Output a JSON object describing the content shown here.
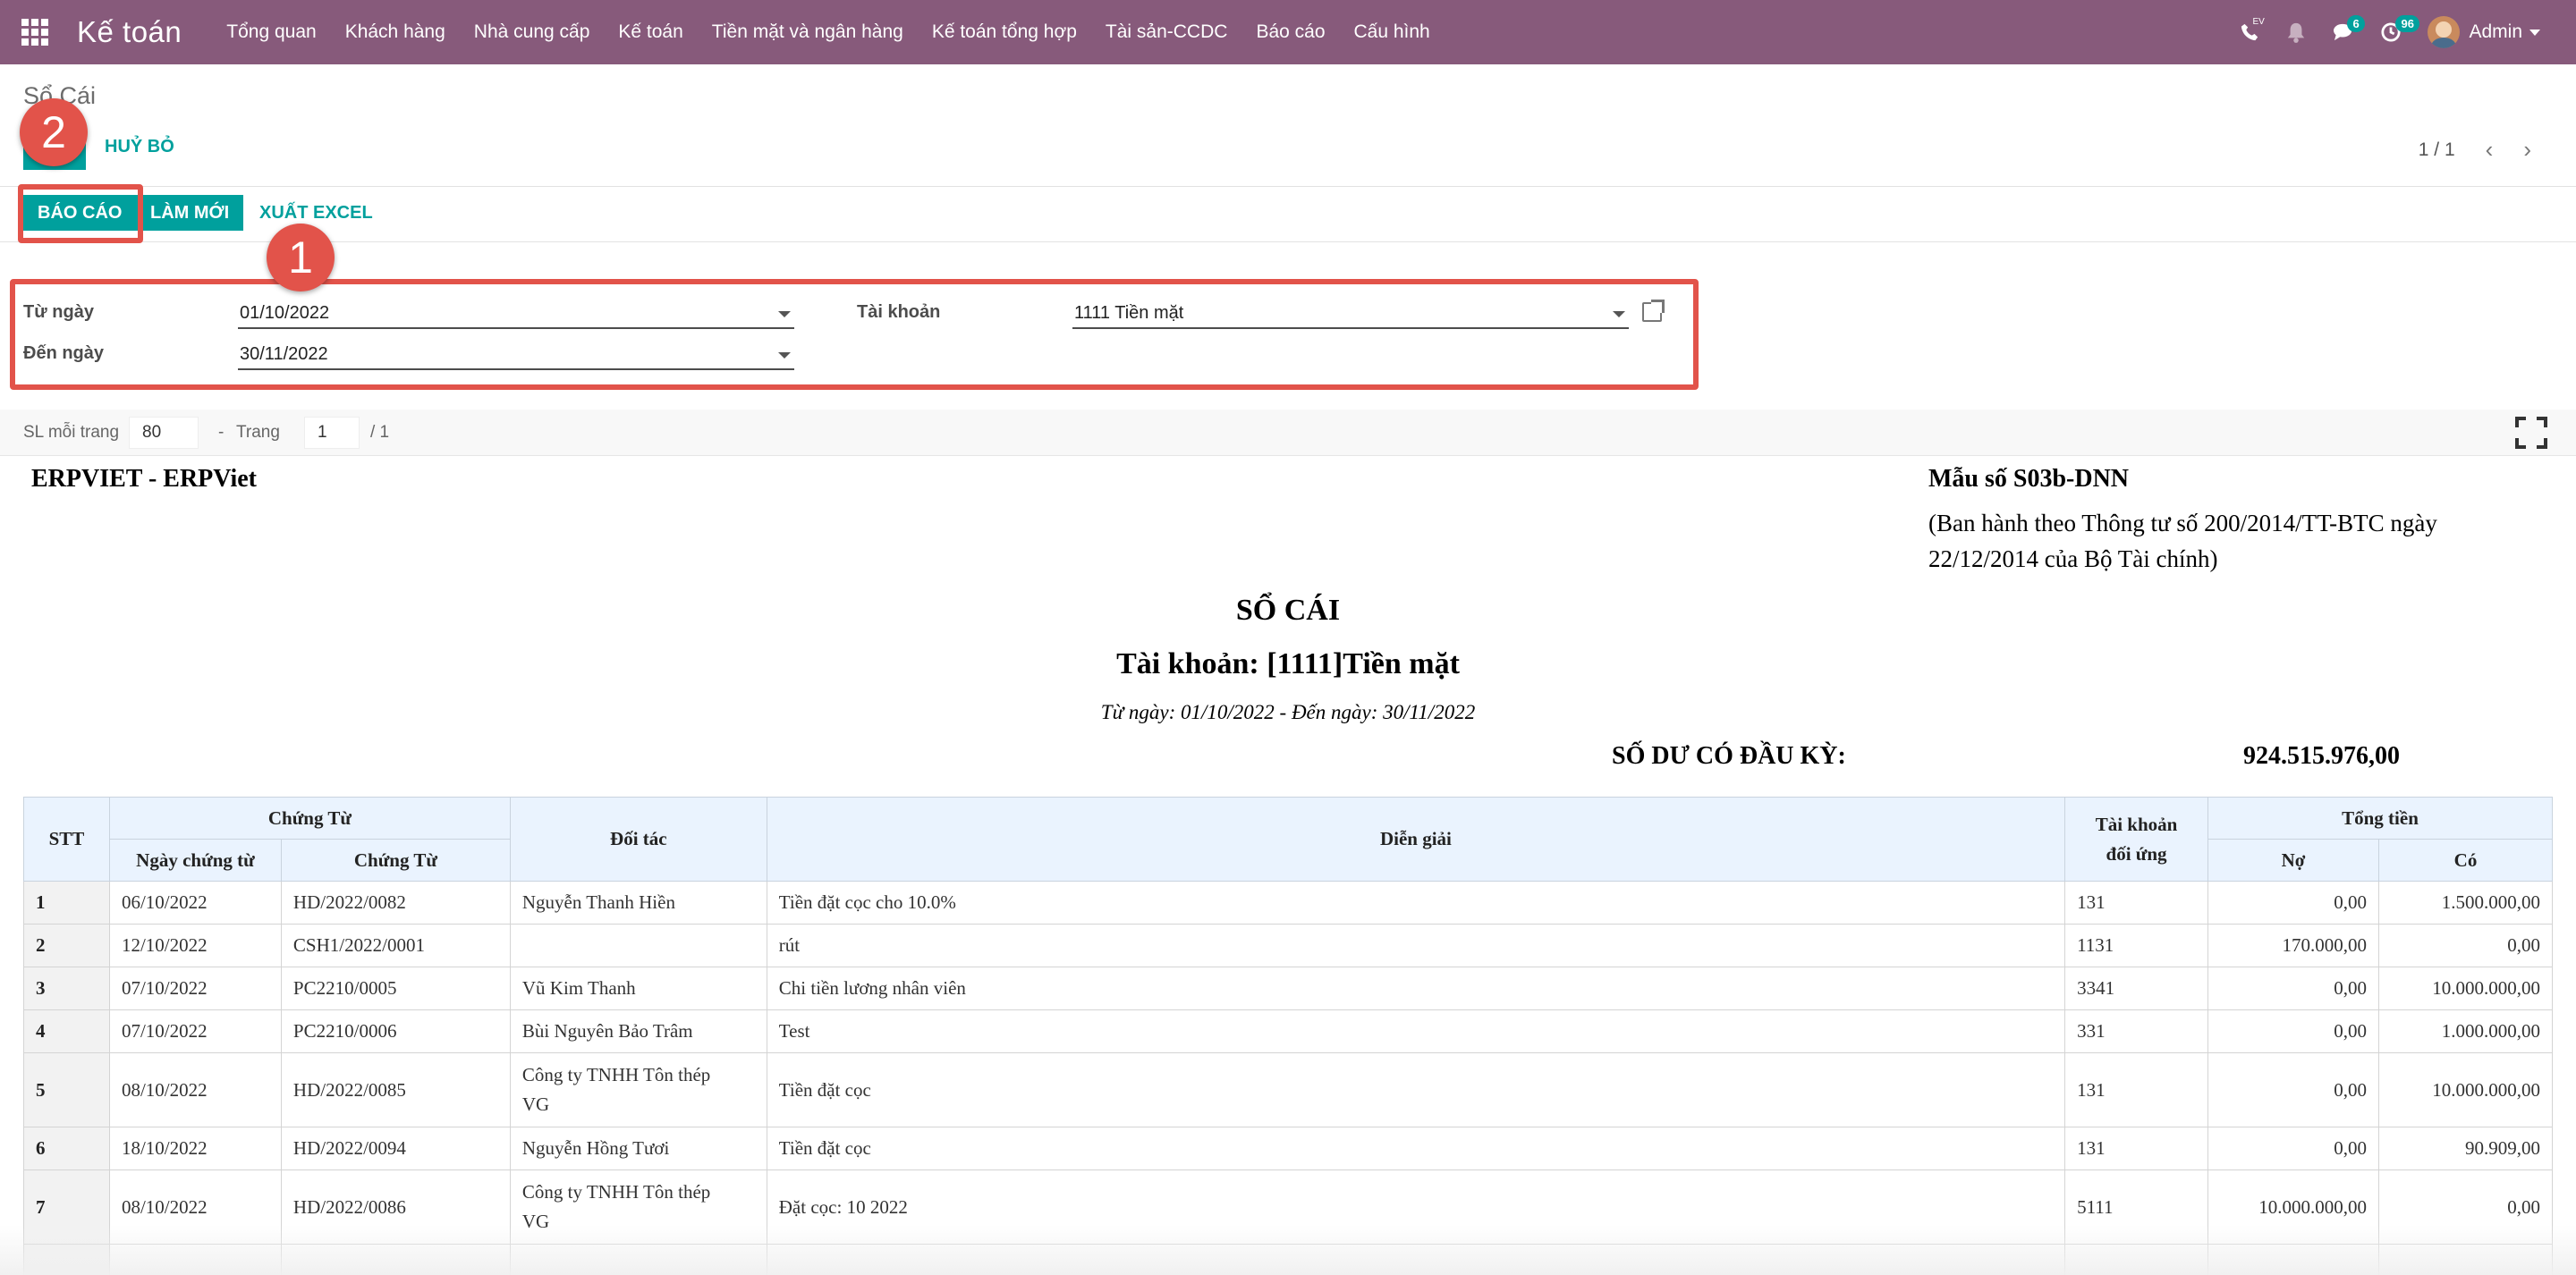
{
  "navbar": {
    "brand": "Kế toán",
    "menu": [
      "Tổng quan",
      "Khách hàng",
      "Nhà cung cấp",
      "Kế toán",
      "Tiền mặt và ngân hàng",
      "Kế toán tổng hợp",
      "Tài sản-CCDC",
      "Báo cáo",
      "Cấu hình"
    ],
    "phone_label": "EV",
    "messages_count": "6",
    "activities_count": "96",
    "user": "Admin",
    "color": "#875a7b"
  },
  "control": {
    "breadcrumb": "Sổ Cái",
    "cancel_label": "HUỶ BỎ",
    "pager": "1 / 1",
    "buttons": {
      "report": "BÁO CÁO",
      "refresh": "LÀM MỚI",
      "export": "XUẤT EXCEL"
    }
  },
  "annotations": {
    "one": "1",
    "two": "2",
    "color": "#e2534a"
  },
  "filters": {
    "from_label": "Từ ngày",
    "from_value": "01/10/2022",
    "to_label": "Đến ngày",
    "to_value": "30/11/2022",
    "account_label": "Tài khoản",
    "account_value": "1111 Tiền mặt"
  },
  "pagination": {
    "per_page_label": "SL mỗi trang",
    "per_page": "80",
    "dash": "-",
    "page_label": "Trang",
    "page": "1",
    "total": "/ 1"
  },
  "report": {
    "company": "ERPVIET - ERPViet",
    "form_no": "Mẫu số S03b-DNN",
    "circular_1": "(Ban hành theo Thông tư số 200/2014/TT-BTC ngày",
    "circular_2": "22/12/2014 của Bộ Tài chính)",
    "title": "SỔ CÁI",
    "account_title": "Tài khoản: [1111]Tiền mặt",
    "period": "Từ ngày: 01/10/2022 - Đến ngày: 30/11/2022",
    "opening_label": "SỐ DƯ CÓ ĐẦU KỲ:",
    "opening_value": "924.515.976,00"
  },
  "table": {
    "headers": {
      "stt": "STT",
      "voucher_group": "Chứng Từ",
      "voucher_date": "Ngày chứng từ",
      "voucher_no": "Chứng Từ",
      "partner": "Đối tác",
      "description": "Diễn giải",
      "contra_1": "Tài khoản",
      "contra_2": "đối ứng",
      "total_group": "Tổng tiền",
      "debit": "Nợ",
      "credit": "Có"
    },
    "rows": [
      {
        "stt": "1",
        "date": "06/10/2022",
        "no": "HD/2022/0082",
        "partner1": "Nguyễn Thanh Hiền",
        "partner2": "",
        "desc": "Tiền đặt cọc cho 10.0%",
        "acc": "131",
        "debit": "0,00",
        "credit": "1.500.000,00"
      },
      {
        "stt": "2",
        "date": "12/10/2022",
        "no": "CSH1/2022/0001",
        "partner1": "",
        "partner2": "",
        "desc": "rút",
        "acc": "1131",
        "debit": "170.000,00",
        "credit": "0,00"
      },
      {
        "stt": "3",
        "date": "07/10/2022",
        "no": "PC2210/0005",
        "partner1": "Vũ Kim Thanh",
        "partner2": "",
        "desc": "Chi tiền lương nhân viên",
        "acc": "3341",
        "debit": "0,00",
        "credit": "10.000.000,00"
      },
      {
        "stt": "4",
        "date": "07/10/2022",
        "no": "PC2210/0006",
        "partner1": "Bùi Nguyên Bảo Trâm",
        "partner2": "",
        "desc": "Test",
        "acc": "331",
        "debit": "0,00",
        "credit": "1.000.000,00"
      },
      {
        "stt": "5",
        "date": "08/10/2022",
        "no": "HD/2022/0085",
        "partner1": "Công ty TNHH Tôn thép",
        "partner2": "VG",
        "desc": "Tiền đặt cọc",
        "acc": "131",
        "debit": "0,00",
        "credit": "10.000.000,00"
      },
      {
        "stt": "6",
        "date": "18/10/2022",
        "no": "HD/2022/0094",
        "partner1": "Nguyễn Hồng Tươi",
        "partner2": "",
        "desc": "Tiền đặt cọc",
        "acc": "131",
        "debit": "0,00",
        "credit": "90.909,00"
      },
      {
        "stt": "7",
        "date": "08/10/2022",
        "no": "HD/2022/0086",
        "partner1": "Công ty TNHH Tôn thép",
        "partner2": "VG",
        "desc": "Đặt cọc: 10 2022",
        "acc": "5111",
        "debit": "10.000.000,00",
        "credit": "0,00"
      }
    ]
  }
}
